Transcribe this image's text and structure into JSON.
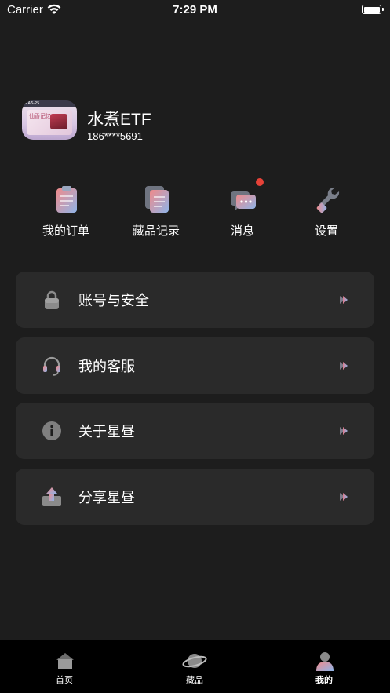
{
  "status_bar": {
    "carrier": "Carrier",
    "time": "7:29 PM"
  },
  "profile": {
    "nickname": "水煮ETF",
    "phone": "186****5691",
    "avatar_text": "AA6-25",
    "avatar_card_text": "仙香记忆"
  },
  "quick_actions": [
    {
      "label": "我的订单",
      "icon": "clipboard-icon"
    },
    {
      "label": "藏品记录",
      "icon": "documents-icon"
    },
    {
      "label": "消息",
      "icon": "chat-bubble-icon",
      "has_unread_badge": true
    },
    {
      "label": "设置",
      "icon": "wrench-icon"
    }
  ],
  "menu": [
    {
      "label": "账号与安全",
      "icon": "lock-icon"
    },
    {
      "label": "我的客服",
      "icon": "headset-icon"
    },
    {
      "label": "关于星昼",
      "icon": "info-icon"
    },
    {
      "label": "分享星昼",
      "icon": "share-icon"
    }
  ],
  "tab_bar": {
    "active_index": 2,
    "tabs": [
      {
        "label": "首页",
        "icon": "home-icon"
      },
      {
        "label": "藏品",
        "icon": "planet-icon"
      },
      {
        "label": "我的",
        "icon": "user-icon"
      }
    ]
  },
  "colors": {
    "background": "#1d1d1d",
    "card": "#2a2a2a",
    "tab_bar": "#000000",
    "badge": "#e64238",
    "accent_gradient": [
      "#f08a8a",
      "#8fb4e8"
    ]
  }
}
